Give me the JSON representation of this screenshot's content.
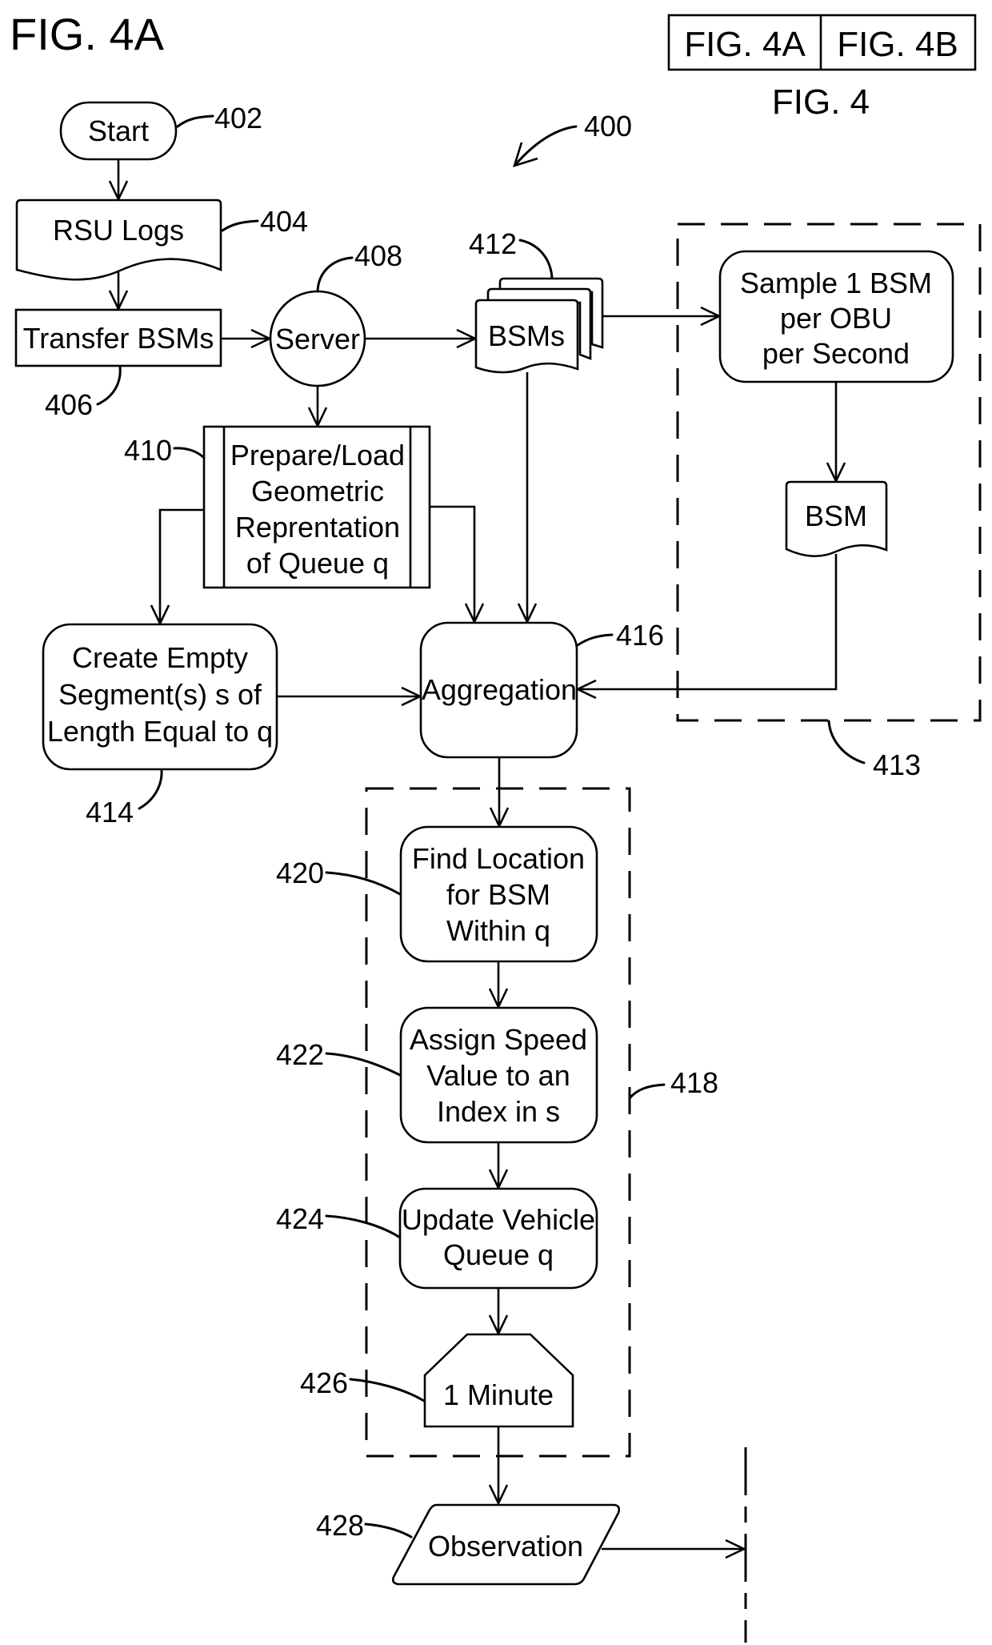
{
  "figure": {
    "title": "FIG. 4A",
    "key_box": [
      "FIG. 4A",
      "FIG. 4B"
    ],
    "key_caption": "FIG. 4",
    "overall_ref": "400"
  },
  "nodes": {
    "start": {
      "lines": [
        "Start"
      ],
      "ref": "402",
      "shape": "terminator"
    },
    "rsu_logs": {
      "lines": [
        "RSU Logs"
      ],
      "ref": "404",
      "shape": "document"
    },
    "transfer": {
      "lines": [
        "Transfer BSMs"
      ],
      "ref": "406",
      "shape": "process"
    },
    "server": {
      "lines": [
        "Server"
      ],
      "ref": "408",
      "shape": "circle"
    },
    "prepare": {
      "lines": [
        "Prepare/Load",
        "Geometric",
        "Reprentation",
        "of Queue q"
      ],
      "ref": "410",
      "shape": "predefined-process"
    },
    "bsms": {
      "lines": [
        "BSMs"
      ],
      "ref": "412",
      "shape": "multi-document"
    },
    "sampling_group": {
      "ref": "413",
      "shape": "dashed-group"
    },
    "sample": {
      "lines": [
        "Sample 1 BSM",
        "per OBU",
        "per Second"
      ],
      "shape": "rounded-process"
    },
    "bsm": {
      "lines": [
        "BSM"
      ],
      "shape": "document"
    },
    "create": {
      "lines": [
        "Create Empty",
        "Segment(s) s of",
        "Length Equal to q"
      ],
      "ref": "414",
      "shape": "rounded-process"
    },
    "aggregation": {
      "lines": [
        "Aggregation"
      ],
      "ref": "416",
      "shape": "rounded-process"
    },
    "loop_group": {
      "ref": "418",
      "shape": "dashed-group"
    },
    "find": {
      "lines": [
        "Find Location",
        "for BSM",
        "Within q"
      ],
      "ref": "420",
      "shape": "rounded-process"
    },
    "assign": {
      "lines": [
        "Assign Speed",
        "Value to an",
        "Index in s"
      ],
      "ref": "422",
      "shape": "rounded-process"
    },
    "update": {
      "lines": [
        "Update Vehicle",
        "Queue q"
      ],
      "ref": "424",
      "shape": "rounded-process"
    },
    "minute": {
      "lines": [
        "1 Minute"
      ],
      "ref": "426",
      "shape": "loop-limit"
    },
    "observation": {
      "lines": [
        "Observation"
      ],
      "ref": "428",
      "shape": "data"
    }
  },
  "edges": [
    {
      "from": "start",
      "to": "rsu_logs"
    },
    {
      "from": "rsu_logs",
      "to": "transfer"
    },
    {
      "from": "transfer",
      "to": "server"
    },
    {
      "from": "server",
      "to": "bsms"
    },
    {
      "from": "server",
      "to": "prepare"
    },
    {
      "from": "bsms",
      "to": "sample"
    },
    {
      "from": "bsms",
      "to": "aggregation"
    },
    {
      "from": "sample",
      "to": "bsm"
    },
    {
      "from": "bsm",
      "to": "aggregation"
    },
    {
      "from": "prepare",
      "to": "create"
    },
    {
      "from": "prepare",
      "to": "aggregation"
    },
    {
      "from": "create",
      "to": "aggregation"
    },
    {
      "from": "aggregation",
      "to": "find"
    },
    {
      "from": "find",
      "to": "assign"
    },
    {
      "from": "assign",
      "to": "update"
    },
    {
      "from": "update",
      "to": "minute"
    },
    {
      "from": "minute",
      "to": "observation"
    },
    {
      "from": "observation",
      "to": "continuation-fig-4b"
    }
  ]
}
